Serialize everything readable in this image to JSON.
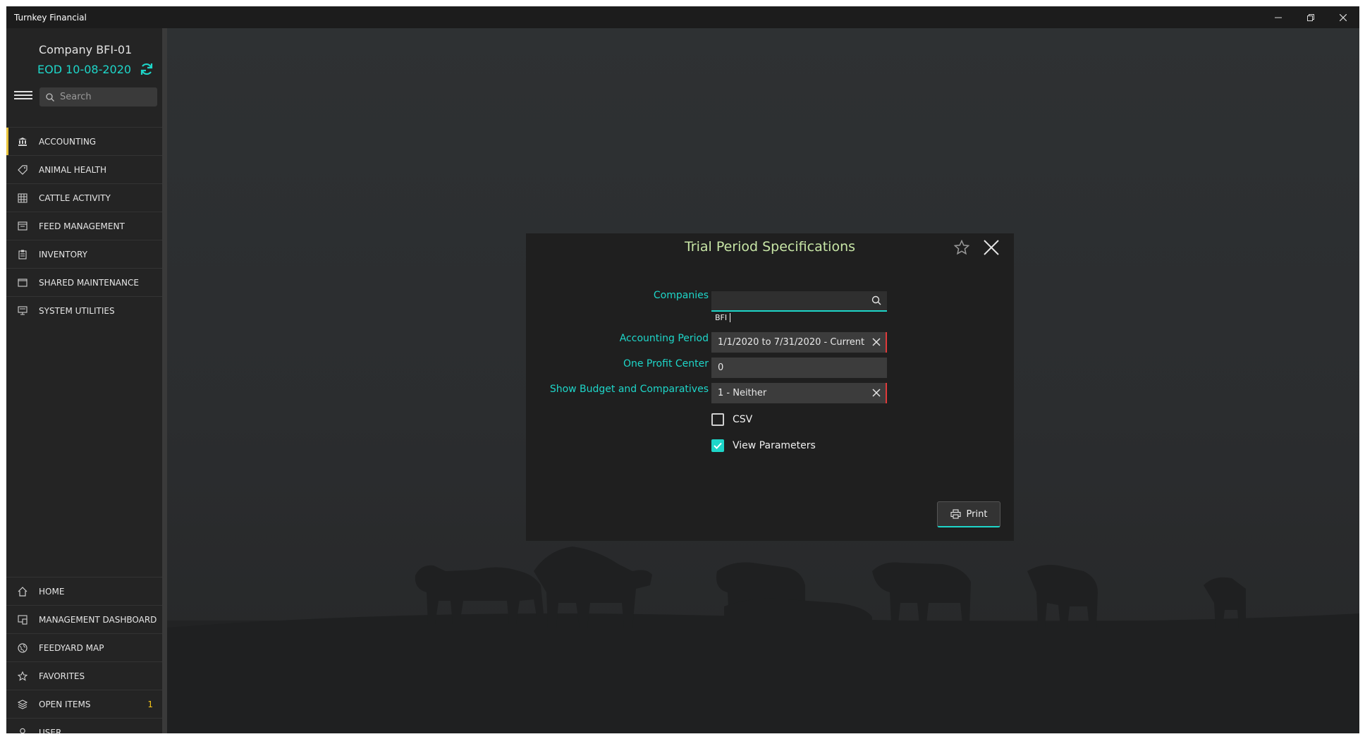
{
  "window": {
    "title": "Turnkey Financial",
    "controls": [
      "minimize-icon",
      "restore-icon",
      "close-icon"
    ]
  },
  "sidebar": {
    "company": "Company BFI-01",
    "eod": "EOD 10-08-2020",
    "search_placeholder": "Search",
    "top_items": [
      {
        "label": "ACCOUNTING",
        "icon": "bank-icon"
      },
      {
        "label": "ANIMAL HEALTH",
        "icon": "tag-icon"
      },
      {
        "label": "CATTLE ACTIVITY",
        "icon": "grid-icon"
      },
      {
        "label": "FEED MANAGEMENT",
        "icon": "feed-icon"
      },
      {
        "label": "INVENTORY",
        "icon": "clipboard-icon"
      },
      {
        "label": "SHARED MAINTENANCE",
        "icon": "folder-icon"
      },
      {
        "label": "SYSTEM UTILITIES",
        "icon": "monitor-icon"
      }
    ],
    "bottom_items": [
      {
        "label": "HOME",
        "icon": "home-icon"
      },
      {
        "label": "MANAGEMENT DASHBOARD",
        "icon": "dashboard-icon"
      },
      {
        "label": "FEEDYARD MAP",
        "icon": "globe-icon"
      },
      {
        "label": "FAVORITES",
        "icon": "star-icon"
      },
      {
        "label": "OPEN ITEMS",
        "icon": "layers-icon",
        "badge": "1"
      },
      {
        "label": "USER",
        "icon": "user-icon"
      }
    ],
    "accent_color": "#1ed6c9",
    "active_indicator_color": "#e8c33a"
  },
  "dialog": {
    "title": "Trial Period Specifications",
    "companies_label": "Companies",
    "companies_value": "",
    "companies_chip": "BFI",
    "accounting_period_label": "Accounting Period",
    "accounting_period_value": "1/1/2020 to 7/31/2020 - Current",
    "profit_center_label": "One Profit Center",
    "profit_center_value": "0",
    "budget_label": "Show Budget and Comparatives",
    "budget_value": "1 - Neither",
    "csv_label": "CSV",
    "csv_checked": false,
    "view_params_label": "View Parameters",
    "view_params_checked": true,
    "print_label": "Print"
  }
}
